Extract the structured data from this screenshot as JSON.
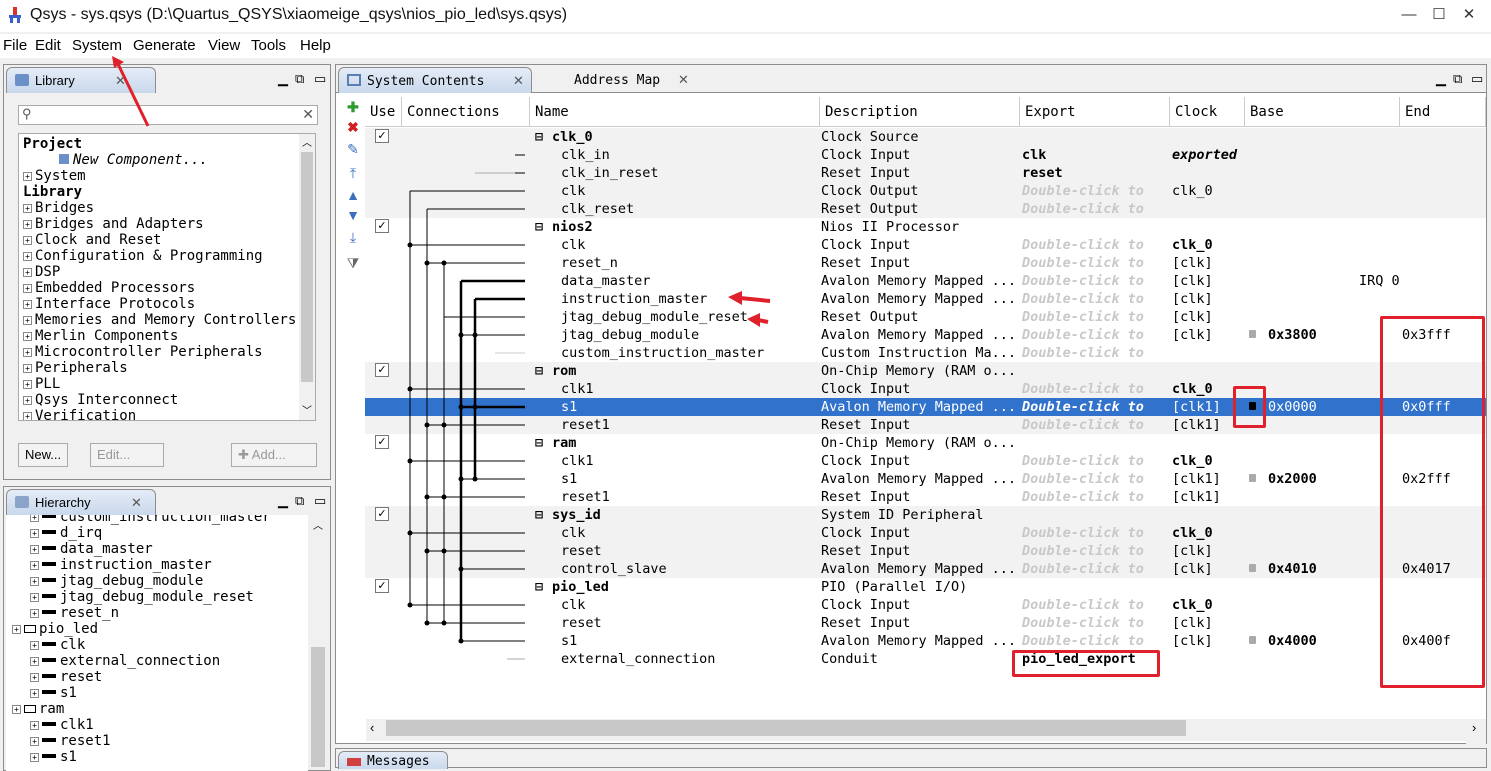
{
  "window": {
    "title": "Qsys - sys.qsys (D:\\Quartus_QSYS\\xiaomeige_qsys\\nios_pio_led\\sys.qsys)",
    "controls": [
      "—",
      "☐",
      "✕"
    ]
  },
  "menu": [
    "File",
    "Edit",
    "System",
    "Generate",
    "View",
    "Tools",
    "Help"
  ],
  "library": {
    "tab": "Library",
    "search_placeholder": "",
    "tree": [
      {
        "t": "Project",
        "b": true,
        "l": 0,
        "p": false
      },
      {
        "t": "New Component...",
        "i": true,
        "l": 2,
        "p": false
      },
      {
        "t": "System",
        "l": 0,
        "p": true
      },
      {
        "t": "Library",
        "b": true,
        "l": 0,
        "p": false
      },
      {
        "t": "Bridges",
        "l": 0,
        "p": true
      },
      {
        "t": "Bridges and Adapters",
        "l": 0,
        "p": true
      },
      {
        "t": "Clock and Reset",
        "l": 0,
        "p": true
      },
      {
        "t": "Configuration & Programming",
        "l": 0,
        "p": true
      },
      {
        "t": "DSP",
        "l": 0,
        "p": true
      },
      {
        "t": "Embedded Processors",
        "l": 0,
        "p": true
      },
      {
        "t": "Interface Protocols",
        "l": 0,
        "p": true
      },
      {
        "t": "Memories and Memory Controllers",
        "l": 0,
        "p": true
      },
      {
        "t": "Merlin Components",
        "l": 0,
        "p": true
      },
      {
        "t": "Microcontroller Peripherals",
        "l": 0,
        "p": true
      },
      {
        "t": "Peripherals",
        "l": 0,
        "p": true
      },
      {
        "t": "PLL",
        "l": 0,
        "p": true
      },
      {
        "t": "Qsys Interconnect",
        "l": 0,
        "p": true
      },
      {
        "t": "Verification",
        "l": 0,
        "p": true
      }
    ],
    "buttons": {
      "new": "New...",
      "edit": "Edit...",
      "add": "Add..."
    }
  },
  "hierarchy": {
    "tab": "Hierarchy",
    "tree": [
      {
        "t": "custom_instruction_master",
        "l": 1
      },
      {
        "t": "d_irq",
        "l": 1
      },
      {
        "t": "data_master",
        "l": 1
      },
      {
        "t": "instruction_master",
        "l": 1
      },
      {
        "t": "jtag_debug_module",
        "l": 1
      },
      {
        "t": "jtag_debug_module_reset",
        "l": 1
      },
      {
        "t": "reset_n",
        "l": 1
      },
      {
        "t": "pio_led",
        "l": 0
      },
      {
        "t": "clk",
        "l": 1
      },
      {
        "t": "external_connection",
        "l": 1
      },
      {
        "t": "reset",
        "l": 1
      },
      {
        "t": "s1",
        "l": 1
      },
      {
        "t": "ram",
        "l": 0
      },
      {
        "t": "clk1",
        "l": 1
      },
      {
        "t": "reset1",
        "l": 1
      },
      {
        "t": "s1",
        "l": 1
      }
    ]
  },
  "system": {
    "tabs": [
      "System Contents",
      "Address Map"
    ],
    "headers": [
      "Use",
      "Connections",
      "Name",
      "Description",
      "Export",
      "Clock",
      "Base",
      "End"
    ],
    "rows": [
      {
        "c": 1,
        "name": "clk_0",
        "g": 1,
        "desc": "Clock Source",
        "exp": "",
        "clk": "",
        "base": "",
        "end": "",
        "sh": 1
      },
      {
        "name": "clk_in",
        "desc": "Clock Input",
        "exp": "clk",
        "eb": 1,
        "clk": "exported",
        "ci": 1,
        "base": "",
        "end": "",
        "sh": 1
      },
      {
        "name": "clk_in_reset",
        "desc": "Reset Input",
        "exp": "reset",
        "eb": 1,
        "clk": "",
        "base": "",
        "end": "",
        "sh": 1
      },
      {
        "name": "clk",
        "desc": "Clock Output",
        "exp": "Double-click to",
        "ed": 1,
        "clk": "clk_0",
        "base": "",
        "end": "",
        "sh": 1
      },
      {
        "name": "clk_reset",
        "desc": "Reset Output",
        "exp": "Double-click to",
        "ed": 1,
        "clk": "",
        "base": "",
        "end": "",
        "sh": 1
      },
      {
        "c": 1,
        "name": "nios2",
        "g": 1,
        "desc": "Nios II Processor",
        "exp": "",
        "clk": "",
        "base": "",
        "end": ""
      },
      {
        "name": "clk",
        "desc": "Clock Input",
        "exp": "Double-click to",
        "ed": 1,
        "clk": "clk_0",
        "cb": 1,
        "base": "",
        "end": ""
      },
      {
        "name": "reset_n",
        "desc": "Reset Input",
        "exp": "Double-click to",
        "ed": 1,
        "clk": "[clk]",
        "base": "",
        "end": ""
      },
      {
        "name": "data_master",
        "desc": "Avalon Memory Mapped ...",
        "exp": "Double-click to",
        "ed": 1,
        "clk": "[clk]",
        "base": "IRQ 0",
        "end": "",
        "irq": 1
      },
      {
        "name": "instruction_master",
        "desc": "Avalon Memory Mapped ...",
        "exp": "Double-click to",
        "ed": 1,
        "clk": "[clk]",
        "base": "",
        "end": ""
      },
      {
        "name": "jtag_debug_module_reset",
        "desc": "Reset Output",
        "exp": "Double-click to",
        "ed": 1,
        "clk": "[clk]",
        "base": "",
        "end": ""
      },
      {
        "name": "jtag_debug_module",
        "desc": "Avalon Memory Mapped ...",
        "exp": "Double-click to",
        "ed": 1,
        "clk": "[clk]",
        "base": "0x3800",
        "bb": 1,
        "lk": 1,
        "end": "0x3fff"
      },
      {
        "name": "custom_instruction_master",
        "desc": "Custom Instruction Ma...",
        "exp": "Double-click to",
        "ed": 1,
        "clk": "",
        "base": "",
        "end": ""
      },
      {
        "c": 1,
        "name": "rom",
        "g": 1,
        "desc": "On-Chip Memory (RAM o...",
        "exp": "",
        "clk": "",
        "base": "",
        "end": "",
        "sh": 1
      },
      {
        "name": "clk1",
        "desc": "Clock Input",
        "exp": "Double-click to",
        "ed": 1,
        "clk": "clk_0",
        "cb": 1,
        "base": "",
        "end": "",
        "sh": 1
      },
      {
        "name": "s1",
        "desc": "Avalon Memory Mapped ...",
        "exp": "Double-click to",
        "ed": 1,
        "clk": "[clk1]",
        "base": "0x0000",
        "lk": 2,
        "end": "0x0fff",
        "sel": 1
      },
      {
        "name": "reset1",
        "desc": "Reset Input",
        "exp": "Double-click to",
        "ed": 1,
        "clk": "[clk1]",
        "base": "",
        "end": "",
        "sh": 1
      },
      {
        "c": 1,
        "name": "ram",
        "g": 1,
        "desc": "On-Chip Memory (RAM o...",
        "exp": "",
        "clk": "",
        "base": "",
        "end": ""
      },
      {
        "name": "clk1",
        "desc": "Clock Input",
        "exp": "Double-click to",
        "ed": 1,
        "clk": "clk_0",
        "cb": 1,
        "base": "",
        "end": ""
      },
      {
        "name": "s1",
        "desc": "Avalon Memory Mapped ...",
        "exp": "Double-click to",
        "ed": 1,
        "clk": "[clk1]",
        "base": "0x2000",
        "bb": 1,
        "lk": 1,
        "end": "0x2fff"
      },
      {
        "name": "reset1",
        "desc": "Reset Input",
        "exp": "Double-click to",
        "ed": 1,
        "clk": "[clk1]",
        "base": "",
        "end": ""
      },
      {
        "c": 1,
        "name": "sys_id",
        "g": 1,
        "desc": "System ID Peripheral",
        "exp": "",
        "clk": "",
        "base": "",
        "end": "",
        "sh": 1
      },
      {
        "name": "clk",
        "desc": "Clock Input",
        "exp": "Double-click to",
        "ed": 1,
        "clk": "clk_0",
        "cb": 1,
        "base": "",
        "end": "",
        "sh": 1
      },
      {
        "name": "reset",
        "desc": "Reset Input",
        "exp": "Double-click to",
        "ed": 1,
        "clk": "[clk]",
        "base": "",
        "end": "",
        "sh": 1
      },
      {
        "name": "control_slave",
        "desc": "Avalon Memory Mapped ...",
        "exp": "Double-click to",
        "ed": 1,
        "clk": "[clk]",
        "base": "0x4010",
        "bb": 1,
        "lk": 1,
        "end": "0x4017",
        "sh": 1
      },
      {
        "c": 1,
        "name": "pio_led",
        "g": 1,
        "desc": "PIO (Parallel I/O)",
        "exp": "",
        "clk": "",
        "base": "",
        "end": ""
      },
      {
        "name": "clk",
        "desc": "Clock Input",
        "exp": "Double-click to",
        "ed": 1,
        "clk": "clk_0",
        "cb": 1,
        "base": "",
        "end": ""
      },
      {
        "name": "reset",
        "desc": "Reset Input",
        "exp": "Double-click to",
        "ed": 1,
        "clk": "[clk]",
        "base": "",
        "end": ""
      },
      {
        "name": "s1",
        "desc": "Avalon Memory Mapped ...",
        "exp": "Double-click to",
        "ed": 1,
        "clk": "[clk]",
        "base": "0x4000",
        "bb": 1,
        "lk": 1,
        "end": "0x400f"
      },
      {
        "name": "external_connection",
        "desc": "Conduit",
        "exp": "pio_led_export",
        "eb": 1,
        "clk": "",
        "base": "",
        "end": ""
      }
    ]
  },
  "messages": {
    "tab": "Messages"
  },
  "colors": {
    "select": "#3072cc",
    "annot": "#e0202a",
    "stripe": "#f2f2f2"
  }
}
